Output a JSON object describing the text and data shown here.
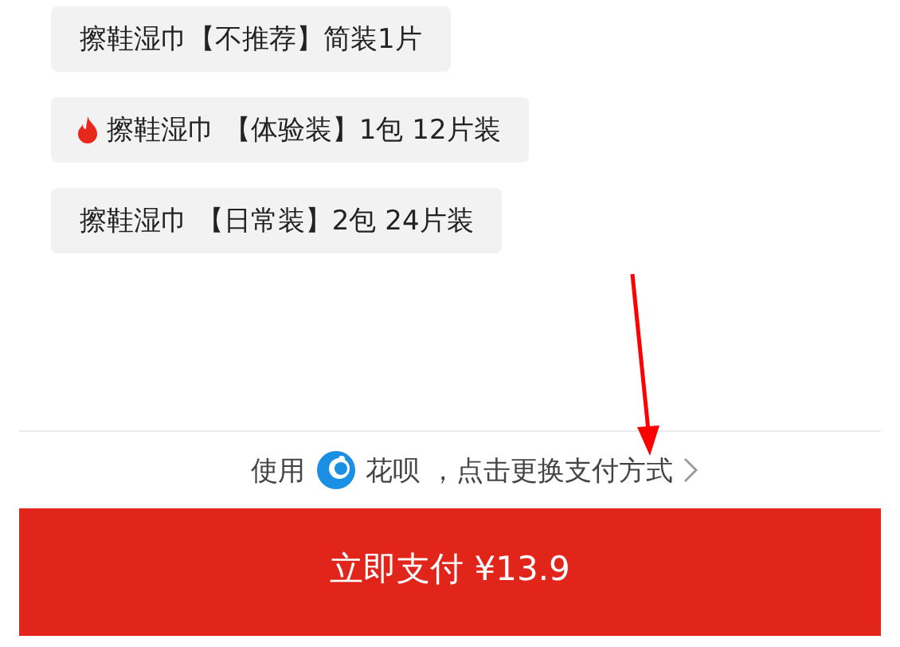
{
  "options": [
    {
      "label": "擦鞋湿巾【不推荐】简装1片",
      "hot": false
    },
    {
      "label": "擦鞋湿巾 【体验装】1包 12片装",
      "hot": true
    },
    {
      "label": "擦鞋湿巾 【日常装】2包 24片装",
      "hot": false
    }
  ],
  "payment": {
    "prefix": "使用",
    "method": "花呗",
    "suffix": "，点击更换支付方式"
  },
  "pay_button": {
    "label": "立即支付 ¥13.9"
  }
}
